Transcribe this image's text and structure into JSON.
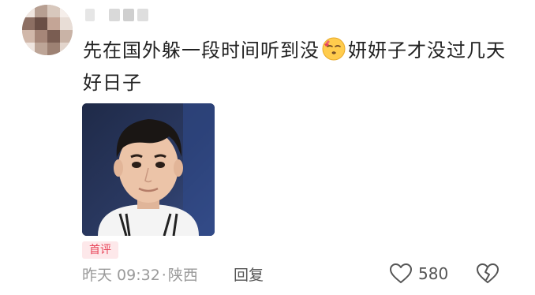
{
  "comment": {
    "text_part1": "先在国外躲一段时间听到没",
    "emoji": "kissing-face-emoji",
    "text_part2": "妍妍子才没过几天好日子"
  },
  "badge": "首评",
  "meta": {
    "time": "昨天 09:32",
    "separator": "·",
    "location": "陕西"
  },
  "actions": {
    "reply_label": "回复",
    "like_count": "580",
    "like_icon": "heart-outline-icon",
    "dislike_icon": "broken-heart-icon"
  },
  "colors": {
    "badge_text": "#e8455a",
    "badge_bg": "#fde8ea",
    "meta_text": "#9a9a9a"
  }
}
